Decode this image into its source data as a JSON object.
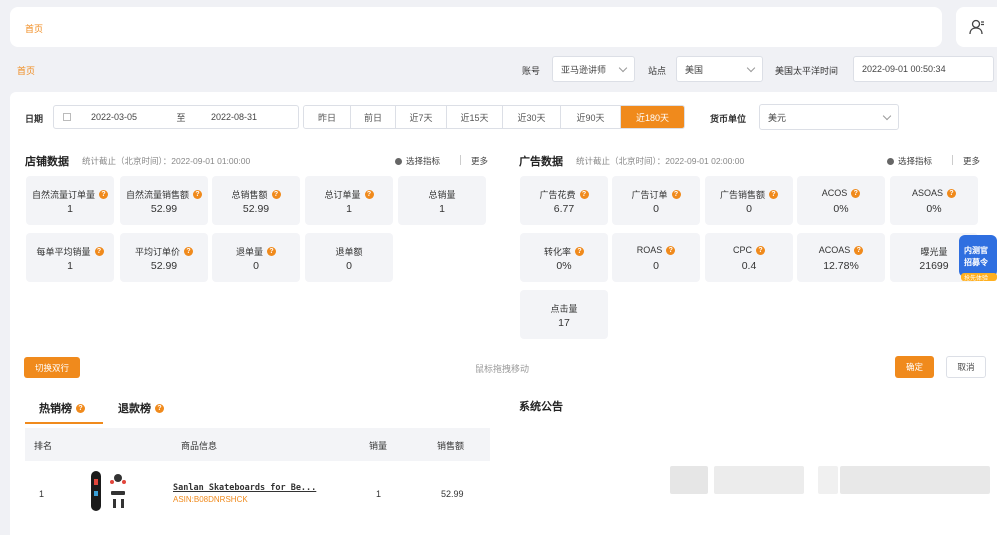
{
  "header": {
    "breadcrumb": "首页"
  },
  "filter": {
    "breadcrumb": "首页",
    "account_label": "账号",
    "account_value": "亚马逊讲师",
    "site_label": "站点",
    "site_value": "美国",
    "tz_label": "美国太平洋时间",
    "tz_value": "2022-09-01 00:50:34"
  },
  "date": {
    "label": "日期",
    "start": "2022-03-05",
    "sep": "至",
    "end": "2022-08-31",
    "quick": [
      "昨日",
      "前日",
      "近7天",
      "近15天",
      "近30天",
      "近90天",
      "近180天"
    ],
    "active": "近180天"
  },
  "currency": {
    "label": "货币单位",
    "value": "美元"
  },
  "store": {
    "title": "店铺数据",
    "note": "统计截止（北京时间）：2022-09-01 01:00:00",
    "select": "选择指标",
    "more": "更多",
    "cards": [
      {
        "label": "自然流量订单量",
        "value": "1"
      },
      {
        "label": "自然流量销售额",
        "value": "52.99"
      },
      {
        "label": "总销售额",
        "value": "52.99"
      },
      {
        "label": "总订单量",
        "value": "1"
      },
      {
        "label": "总销量",
        "value": "1"
      },
      {
        "label": "每单平均销量",
        "value": "1"
      },
      {
        "label": "平均订单价",
        "value": "52.99"
      },
      {
        "label": "退单量",
        "value": "0"
      },
      {
        "label": "退单额",
        "value": "0"
      }
    ]
  },
  "ads": {
    "title": "广告数据",
    "note": "统计截止（北京时间）：2022-09-01 02:00:00",
    "select": "选择指标",
    "more": "更多",
    "cards": [
      {
        "label": "广告花费",
        "value": "6.77"
      },
      {
        "label": "广告订单",
        "value": "0"
      },
      {
        "label": "广告销售额",
        "value": "0"
      },
      {
        "label": "ACOS",
        "value": "0%"
      },
      {
        "label": "ASOAS",
        "value": "0%"
      },
      {
        "label": "转化率",
        "value": "0%"
      },
      {
        "label": "ROAS",
        "value": "0"
      },
      {
        "label": "CPC",
        "value": "0.4"
      },
      {
        "label": "ACOAS",
        "value": "12.78%"
      },
      {
        "label": "曝光量",
        "value": "21699"
      },
      {
        "label": "点击量",
        "value": "17"
      }
    ]
  },
  "actions": {
    "toggle": "切换双行",
    "drag_hint": "鼠标拖拽移动",
    "confirm": "确定",
    "cancel": "取消"
  },
  "tabs": {
    "hot": "热销榜",
    "refund": "退款榜"
  },
  "notice_title": "系统公告",
  "table": {
    "headers": [
      "排名",
      "商品信息",
      "销量",
      "销售额"
    ],
    "rows": [
      {
        "rank": "1",
        "name": "Sanlan Skateboards for Be...",
        "asin": "ASIN:B08DNRSHCK",
        "qty": "1",
        "sales": "52.99"
      }
    ]
  },
  "side_badge": {
    "line1": "内测官",
    "line2": "招募令",
    "line3": "抢先体验"
  },
  "colors": {
    "accent": "#f08a1c",
    "card_bg": "#f3f4f7"
  }
}
